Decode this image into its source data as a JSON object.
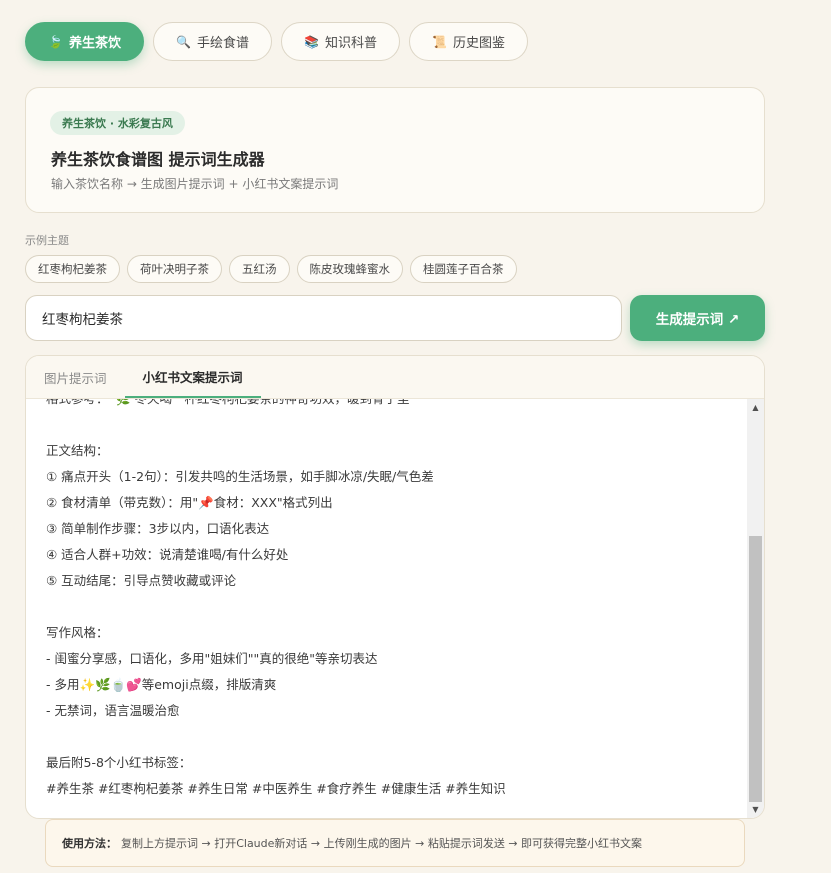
{
  "top_tabs": [
    {
      "icon": "tea-leaf-icon",
      "glyph": "🍃",
      "label": "养生茶饮",
      "active": true
    },
    {
      "icon": "search-icon",
      "glyph": "🔍",
      "label": "手绘食谱",
      "active": false
    },
    {
      "icon": "books-icon",
      "glyph": "📚",
      "label": "知识科普",
      "active": false
    },
    {
      "icon": "scroll-icon",
      "glyph": "📜",
      "label": "历史图鉴",
      "active": false
    }
  ],
  "header": {
    "tag": "养生茶饮 · 水彩复古风",
    "title": "养生茶饮食谱图 提示词生成器",
    "subtitle": "输入茶饮名称 → 生成图片提示词 + 小红书文案提示词"
  },
  "examples": {
    "label": "示例主题",
    "chips": [
      "红枣枸杞姜茶",
      "荷叶决明子茶",
      "五红汤",
      "陈皮玫瑰蜂蜜水",
      "桂圆莲子百合茶"
    ]
  },
  "input": {
    "value": "红枣枸杞姜茶"
  },
  "generate_button": {
    "label": "生成提示词 ↗"
  },
  "panel": {
    "tabs": [
      "图片提示词",
      "小红书文案提示词"
    ],
    "active_tab": 1,
    "lines": [
      "格式参考：“🌿 冬天喝一杯红枣枸杞姜茶的神奇功效，暖到骨子里”",
      "",
      "正文结构：",
      "① 痛点开头（1-2句）：引发共鸣的生活场景，如手脚冰凉/失眠/气色差",
      "② 食材清单（带克数）：用\"📌食材：XXX\"格式列出",
      "③ 简单制作步骤：3步以内，口语化表达",
      "④ 适合人群+功效：说清楚谁喝/有什么好处",
      "⑤ 互动结尾：引导点赞收藏或评论",
      "",
      "写作风格：",
      "- 闺蜜分享感，口语化，多用\"姐妹们\"\"真的很绝\"等亲切表达",
      "- 多用✨🌿🍵💕等emoji点缀，排版清爽",
      "- 无禁词，语言温暖治愈",
      "",
      "最后附5-8个小红书标签：",
      "#养生茶 #红枣枸杞姜茶 #养生日常 #中医养生 #食疗养生 #健康生活 #养生知识"
    ]
  },
  "howto": {
    "label": "使用方法：",
    "text": "复制上方提示词 → 打开Claude新对话 → 上传刚生成的图片 → 粘贴提示词发送 → 即可获得完整小红书文案"
  },
  "colors": {
    "accent": "#4caf7d",
    "background": "#f8f4ec",
    "tag_bg": "#e3f1e6"
  }
}
